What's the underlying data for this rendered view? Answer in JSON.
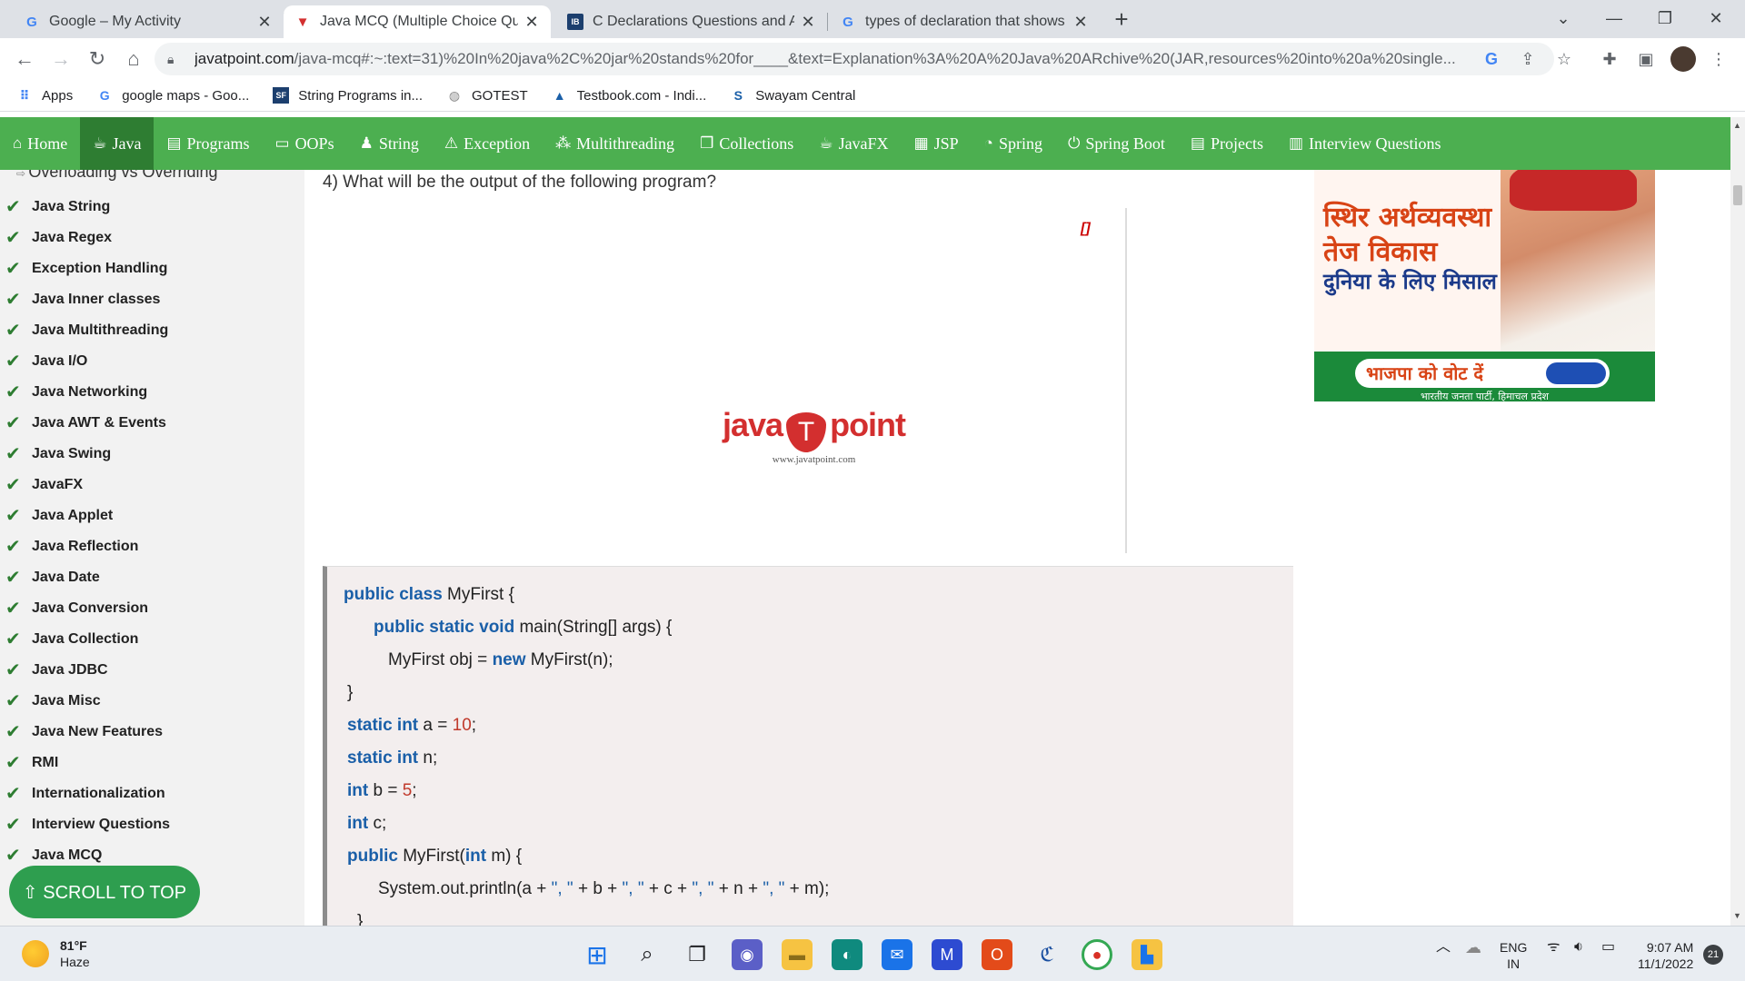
{
  "browser": {
    "tabs": [
      {
        "title": "Google – My Activity",
        "icon": "google-icon"
      },
      {
        "title": "Java MCQ (Multiple Choice Ques",
        "icon": "javatpoint-icon"
      },
      {
        "title": "C Declarations Questions and An",
        "icon": "indiabix-icon"
      },
      {
        "title": "types of declaration that shows a",
        "icon": "google-icon"
      }
    ],
    "url_host": "javatpoint.com",
    "url_rest": "/java-mcq#:~:text=31)%20In%20java%2C%20jar%20stands%20for____&text=Explanation%3A%20A%20Java%20ARchive%20(JAR,resources%20into%20a%20single...",
    "bookmarks": [
      {
        "label": "Apps",
        "icon": "apps-grid-icon"
      },
      {
        "label": "google maps - Goo...",
        "icon": "google-icon"
      },
      {
        "label": "String Programs in...",
        "icon": "sf-icon"
      },
      {
        "label": "GOTEST",
        "icon": "globe-icon"
      },
      {
        "label": "Testbook.com - Indi...",
        "icon": "testbook-icon"
      },
      {
        "label": "Swayam Central",
        "icon": "swayam-icon"
      }
    ]
  },
  "site_nav": [
    {
      "label": "Home",
      "icon": "home-icon"
    },
    {
      "label": "Java",
      "icon": "java-icon",
      "active": true
    },
    {
      "label": "Programs",
      "icon": "programs-icon"
    },
    {
      "label": "OOPs",
      "icon": "oops-icon"
    },
    {
      "label": "String",
      "icon": "string-icon"
    },
    {
      "label": "Exception",
      "icon": "warning-icon"
    },
    {
      "label": "Multithreading",
      "icon": "threads-icon"
    },
    {
      "label": "Collections",
      "icon": "collections-icon"
    },
    {
      "label": "JavaFX",
      "icon": "javafx-icon"
    },
    {
      "label": "JSP",
      "icon": "jsp-icon"
    },
    {
      "label": "Spring",
      "icon": "spring-icon"
    },
    {
      "label": "Spring Boot",
      "icon": "power-icon"
    },
    {
      "label": "Projects",
      "icon": "projects-icon"
    },
    {
      "label": "Interview Questions",
      "icon": "interview-icon"
    }
  ],
  "sidebar": {
    "top_partial": "Overloading vs Overriding",
    "items": [
      "Java String",
      "Java Regex",
      "Exception Handling",
      "Java Inner classes",
      "Java Multithreading",
      "Java I/O",
      "Java Networking",
      "Java AWT & Events",
      "Java Swing",
      "JavaFX",
      "Java Applet",
      "Java Reflection",
      "Java Date",
      "Java Conversion",
      "Java Collection",
      "Java JDBC",
      "Java Misc",
      "Java New Features",
      "RMI",
      "Internationalization",
      "Interview Questions",
      "Java MCQ"
    ],
    "scroll_top": "⇧ SCROLL TO TOP"
  },
  "main": {
    "question": "4) What will be the output of the following program?",
    "ad_marker": "[]",
    "logo_java": "java",
    "logo_t": "T",
    "logo_point": "point",
    "logo_url": "www.javatpoint.com"
  },
  "right_ad": {
    "line1": "स्थिर अर्थव्यवस्था",
    "line2": "तेज विकास",
    "line3": "दुनिया के लिए मिसाल",
    "vote": "भाजपा को वोट दें",
    "party": "भारतीय जनता पार्टी, हिमाचल प्रदेश"
  },
  "taskbar": {
    "temp": "81°F",
    "weather": "Haze",
    "lang1": "ENG",
    "lang2": "IN",
    "time": "9:07 AM",
    "date": "11/1/2022",
    "notifications": "21"
  },
  "colors": {
    "site_green": "#4caf50",
    "site_green_active": "#2e7d32",
    "keyword_blue": "#1a5fa8",
    "number_red": "#c0392b"
  }
}
